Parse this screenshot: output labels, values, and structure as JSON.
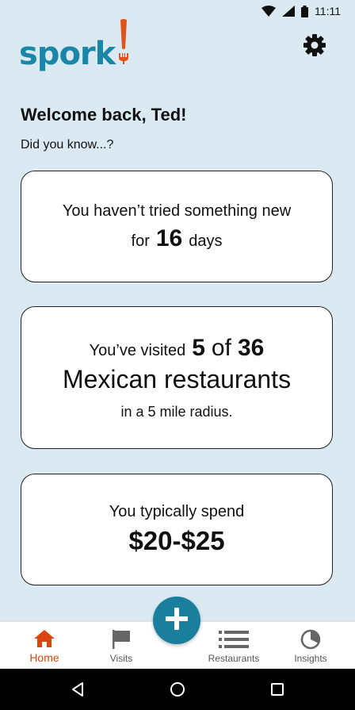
{
  "status": {
    "time": "11:11",
    "icons": [
      "wifi-icon",
      "signal-icon",
      "battery-icon"
    ]
  },
  "app": {
    "logo_text": "spork",
    "logo_mark": "!",
    "logo_color": "#1a87a8",
    "accent_color": "#d9460e"
  },
  "header": {
    "settings_icon": "gear-icon"
  },
  "welcome": {
    "title": "Welcome back, Ted!",
    "subtitle": "Did you know...?"
  },
  "cards": {
    "new_try": {
      "line1": "You haven’t tried something new",
      "prefix": "for",
      "days": "16",
      "suffix": "days"
    },
    "visited": {
      "prefix": "You’ve visited",
      "count": "5",
      "of": "of",
      "total": "36",
      "cuisine": "Mexican restaurants",
      "radius": "in a 5 mile radius."
    },
    "spend": {
      "label": "You typically spend",
      "value": "$20-$25"
    }
  },
  "nav": {
    "items": [
      {
        "label": "Home",
        "icon": "home-icon",
        "active": true
      },
      {
        "label": "Visits",
        "icon": "flag-icon",
        "active": false
      },
      {
        "label": "Restaurants",
        "icon": "list-icon",
        "active": false
      },
      {
        "label": "Insights",
        "icon": "pie-chart-icon",
        "active": false
      }
    ],
    "fab_icon": "plus-icon"
  },
  "system_nav": {
    "icons": [
      "back-icon",
      "home-circle-icon",
      "recents-icon"
    ]
  }
}
